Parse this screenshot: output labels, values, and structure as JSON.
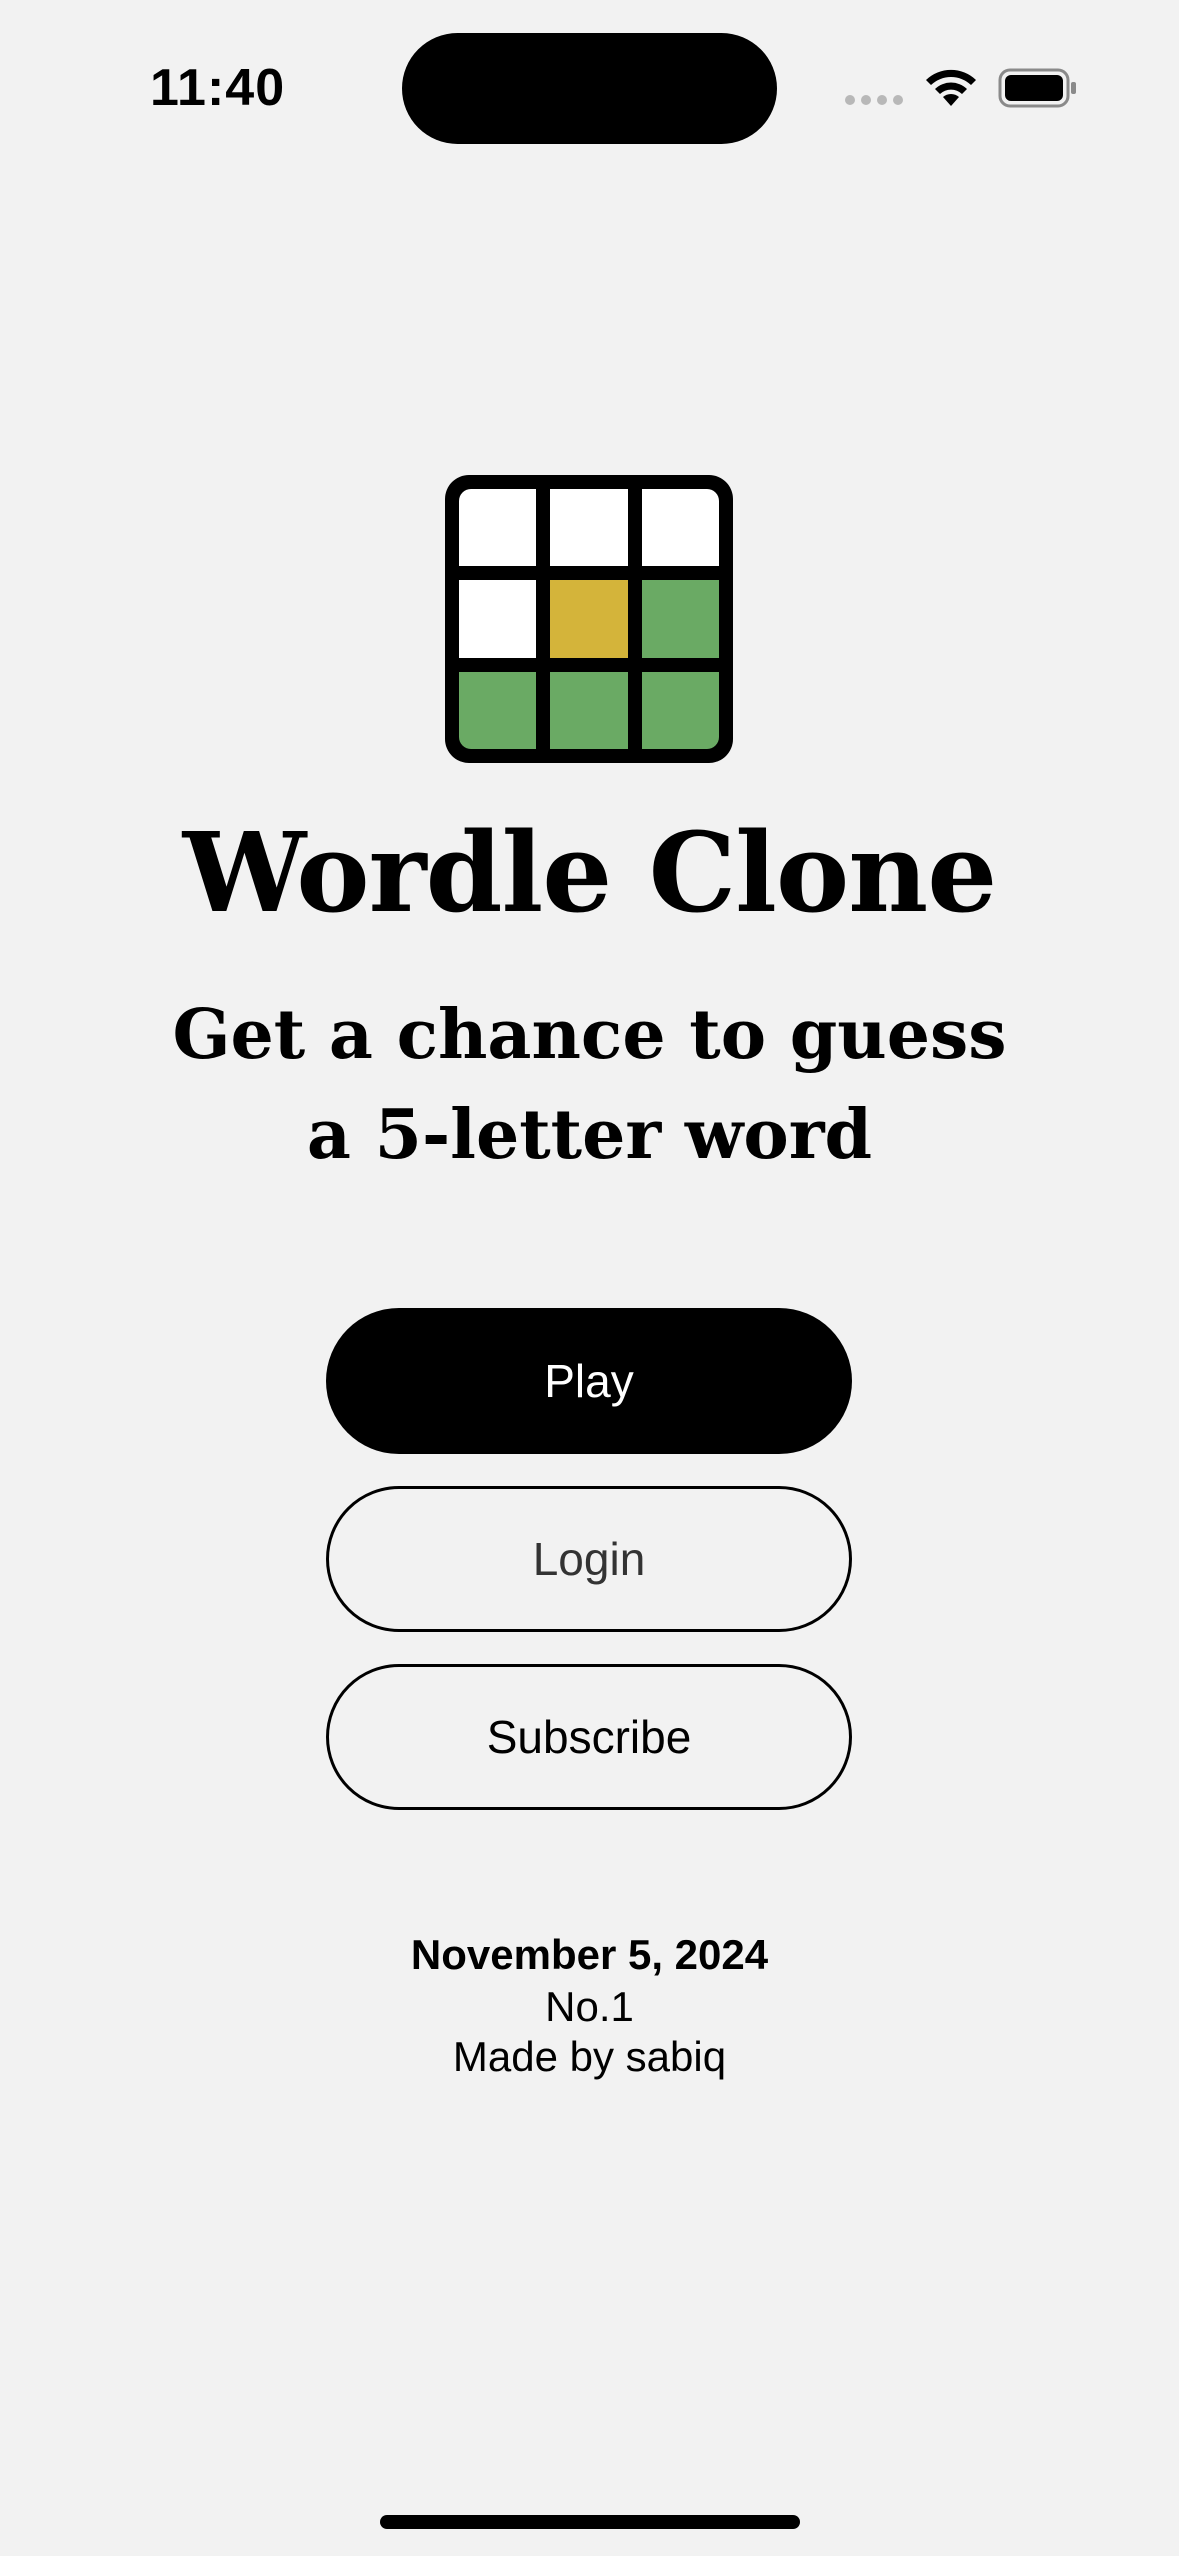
{
  "status_bar": {
    "time": "11:40"
  },
  "logo": {
    "tiles": [
      "white",
      "white",
      "white",
      "white",
      "yellow",
      "green",
      "green",
      "green",
      "green"
    ],
    "colors": {
      "white": "#ffffff",
      "yellow": "#d4b43a",
      "green": "#6aaa64",
      "border": "#000000"
    }
  },
  "title": "Wordle Clone",
  "subtitle": "Get a chance to guess a 5-letter word",
  "buttons": {
    "play": "Play",
    "login": "Login",
    "subscribe": "Subscribe"
  },
  "footer": {
    "date": "November 5, 2024",
    "number": "No.1",
    "author": "Made by sabiq"
  }
}
